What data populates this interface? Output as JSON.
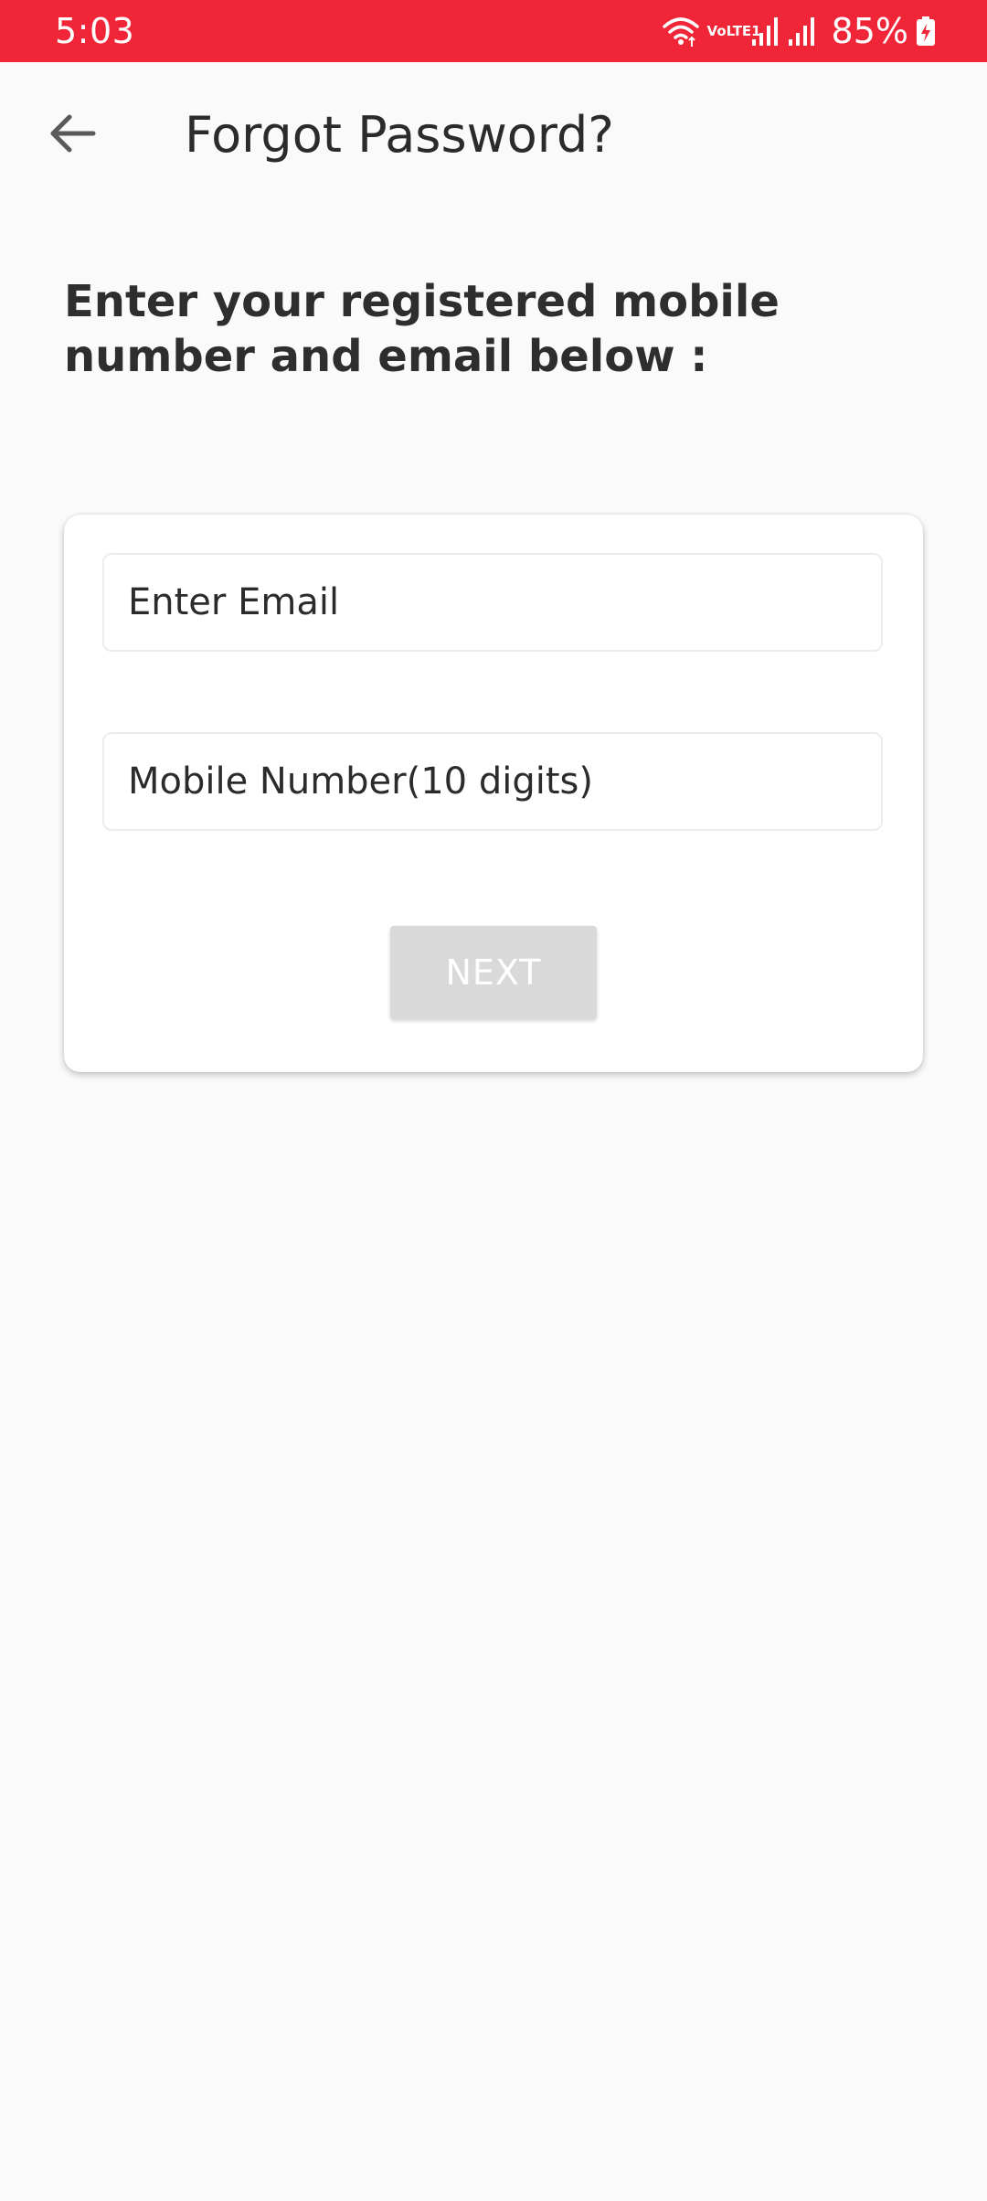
{
  "status_bar": {
    "time": "5:03",
    "network": "VoLTE1",
    "battery": "85%",
    "background_color": "#f02638",
    "icons": [
      "wifi-icon",
      "volte-icon",
      "signal-icon",
      "signal-icon",
      "battery-charging-icon"
    ]
  },
  "app_bar": {
    "back_icon": "arrow-left-icon",
    "title": "Forgot Password?"
  },
  "instruction": "Enter your registered mobile number and email below :",
  "form": {
    "email_placeholder": "Enter Email",
    "email_value": "",
    "mobile_placeholder": "Mobile Number(10 digits)",
    "mobile_value": "",
    "next_label": "NEXT",
    "next_enabled": false
  }
}
